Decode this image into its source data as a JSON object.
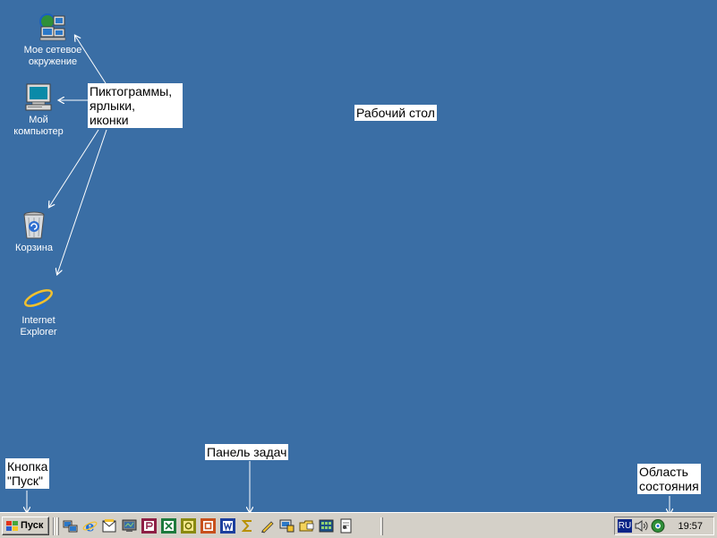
{
  "desktop": {
    "background_color": "#3a6ea5",
    "icons": [
      {
        "label_line1": "Мое сетевое",
        "label_line2": "окружение",
        "icon": "network-neighborhood-icon"
      },
      {
        "label_line1": "Мой",
        "label_line2": "компьютер",
        "icon": "my-computer-icon"
      },
      {
        "label_line1": "Корзина",
        "label_line2": "",
        "icon": "recycle-bin-icon"
      },
      {
        "label_line1": "Internet",
        "label_line2": "Explorer",
        "icon": "internet-explorer-icon"
      }
    ]
  },
  "callouts": {
    "icons_line1": "Пиктограммы,",
    "icons_line2": "ярлыки,",
    "icons_line3": "иконки",
    "desktop": "Рабочий стол",
    "start_line1": "Кнопка",
    "start_line2": "\"Пуск\"",
    "taskbar": "Панель задач",
    "tray_line1": "Область",
    "tray_line2": "состояния"
  },
  "taskbar": {
    "start_label": "Пуск",
    "quick_launch_icons": [
      "network-icon",
      "internet-explorer-icon",
      "outlook-icon",
      "desktop-icon",
      "powerpoint-icon",
      "excel-icon",
      "access-icon",
      "office-icon",
      "word-icon",
      "sigma-icon",
      "pen-icon",
      "monitor-icon",
      "folder-icon",
      "calculator-icon",
      "notepad-icon"
    ],
    "tray": {
      "language": "RU",
      "icons": [
        "volume-icon",
        "network-status-icon"
      ],
      "clock": "19:57"
    },
    "background_color": "#d4d0c8"
  }
}
